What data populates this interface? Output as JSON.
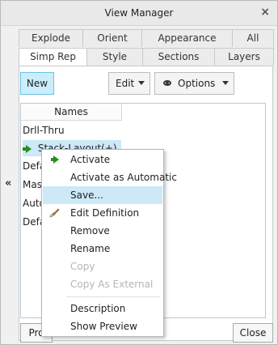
{
  "window": {
    "title": "View Manager",
    "close": "×"
  },
  "collapse": "«",
  "tabs": {
    "row1": [
      "Explode",
      "Orient",
      "Appearance",
      "All"
    ],
    "row2": [
      "Simp Rep",
      "Style",
      "Sections",
      "Layers"
    ]
  },
  "toolbar": {
    "new_label": "New",
    "edit_label": "Edit",
    "options_label": "Options"
  },
  "list": {
    "header": "Names",
    "rows": [
      "Drll-Thru",
      "Stack-Layout(+)",
      "Defa",
      "Mast",
      "Auto",
      "Defa"
    ]
  },
  "context_menu": {
    "items": [
      "Activate",
      "Activate as Automatic",
      "Save...",
      "Edit Definition",
      "Remove",
      "Rename",
      "Copy",
      "Copy As External",
      "Description",
      "Show Preview"
    ]
  },
  "footer": {
    "properties_label": "Pro",
    "close_label": "Close"
  },
  "colors": {
    "selection": "#cde8f7",
    "accent_button": "#cbeefb",
    "active_arrow": "#2a8c1e"
  }
}
